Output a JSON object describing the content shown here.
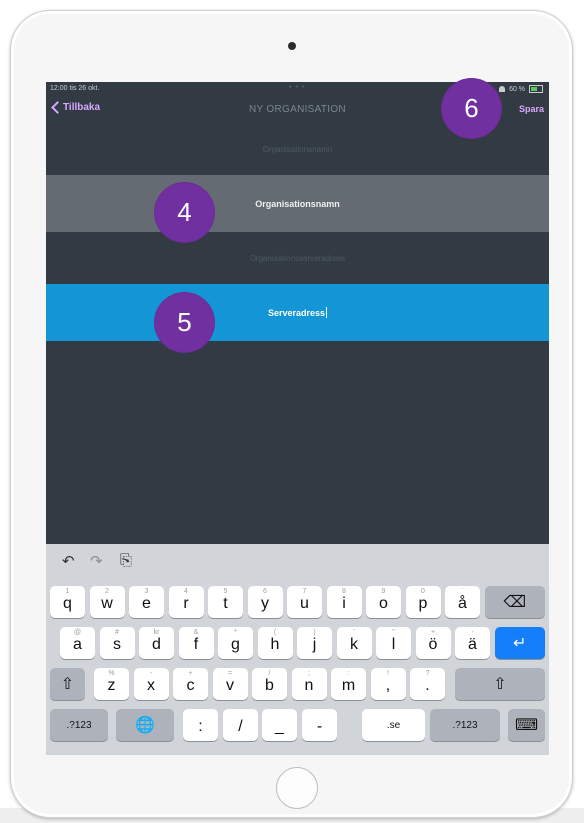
{
  "status": {
    "time": "12:00  tis 26 okt.",
    "dots": "• • •",
    "battery": "60 %"
  },
  "nav": {
    "back_label": "Tillbaka",
    "title": "NY ORGANISATION",
    "save_label": "Spara"
  },
  "form": {
    "org_label": "Organisationsnamn",
    "org_placeholder": "Organisationsnamn",
    "server_label": "Organisationsserveradress",
    "server_placeholder": "Serveradress"
  },
  "badges": [
    "4",
    "5",
    "6"
  ],
  "keyboard": {
    "toolbar": {
      "undo_icon": "↶",
      "redo_icon": "↷",
      "paste_icon": "⎘"
    },
    "row1": [
      {
        "k": "q",
        "s": "1"
      },
      {
        "k": "w",
        "s": "2"
      },
      {
        "k": "e",
        "s": "3"
      },
      {
        "k": "r",
        "s": "4"
      },
      {
        "k": "t",
        "s": "5"
      },
      {
        "k": "y",
        "s": "6"
      },
      {
        "k": "u",
        "s": "7"
      },
      {
        "k": "i",
        "s": "8"
      },
      {
        "k": "o",
        "s": "9"
      },
      {
        "k": "p",
        "s": "0"
      },
      {
        "k": "å",
        "s": "`"
      }
    ],
    "row2": [
      {
        "k": "a",
        "s": "@"
      },
      {
        "k": "s",
        "s": "#"
      },
      {
        "k": "d",
        "s": "kr"
      },
      {
        "k": "f",
        "s": "&"
      },
      {
        "k": "g",
        "s": "*"
      },
      {
        "k": "h",
        "s": "("
      },
      {
        "k": "j",
        "s": ")"
      },
      {
        "k": "k",
        "s": "'"
      },
      {
        "k": "l",
        "s": "\""
      },
      {
        "k": "ö",
        "s": "+"
      },
      {
        "k": "ä",
        "s": "-"
      }
    ],
    "row3": [
      {
        "k": "z",
        "s": "%"
      },
      {
        "k": "x",
        "s": "-"
      },
      {
        "k": "c",
        "s": "+"
      },
      {
        "k": "v",
        "s": "="
      },
      {
        "k": "b",
        "s": "/"
      },
      {
        "k": "n",
        "s": ";"
      },
      {
        "k": "m",
        "s": ":"
      },
      {
        "k": ",",
        "s": "!"
      },
      {
        "k": ".",
        "s": "?"
      }
    ],
    "row4": [
      ".?123",
      ":",
      "/",
      "_",
      "-",
      ".se",
      ".?123"
    ],
    "icons": {
      "backspace": "⌫",
      "return": "↵",
      "shift": "⇧",
      "globe": "🌐",
      "hide": "⌨"
    }
  }
}
